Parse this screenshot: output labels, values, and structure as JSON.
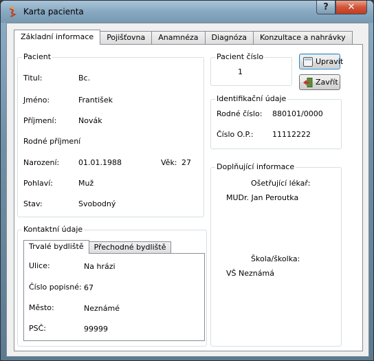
{
  "window": {
    "title": "Karta pacienta",
    "help_label": "?",
    "close_label": "✕"
  },
  "tabs": [
    "Základní informace",
    "Pojišťovna",
    "Anamnéza",
    "Diagnóza",
    "Konzultace a nahrávky"
  ],
  "pacient": {
    "group_title": "Pacient",
    "titul_label": "Titul:",
    "titul_value": "Bc.",
    "jmeno_label": "Jméno:",
    "jmeno_value": "František",
    "prijmeni_label": "Příjmení:",
    "prijmeni_value": "Novák",
    "rodne_prijmeni_label": "Rodné příjmení",
    "rodne_prijmeni_value": "",
    "narozeni_label": "Narození:",
    "narozeni_value": "01.01.1988",
    "vek_label": "Věk:",
    "vek_value": "27",
    "pohlavi_label": "Pohlaví:",
    "pohlavi_value": "Muž",
    "stav_label": "Stav:",
    "stav_value": "Svobodný"
  },
  "pacient_cislo": {
    "group_title": "Pacient číslo",
    "value": "1"
  },
  "buttons": {
    "upravit": "Upravit",
    "zavrit": "Zavřít"
  },
  "identifikace": {
    "group_title": "Identifikační údaje",
    "rodne_cislo_label": "Rodné číslo:",
    "rodne_cislo_value": "880101/0000",
    "cislo_op_label": "Číslo O.P.:",
    "cislo_op_value": "11112222"
  },
  "doplnujici": {
    "group_title": "Doplňující informace",
    "lekar_label": "Ošetřující lékař:",
    "lekar_value": "MUDr. Jan Peroutka",
    "skola_label": "Škola/školka:",
    "skola_value": "VŠ Neznámá"
  },
  "kontakt": {
    "group_title": "Kontaktní údaje",
    "subtabs": [
      "Trvalé bydliště",
      "Přechodné bydliště"
    ],
    "ulice_label": "Ulice:",
    "ulice_value": "Na hrázi",
    "cp_label": "Číslo popisné:",
    "cp_value": "67",
    "mesto_label": "Město:",
    "mesto_value": "Neznámé",
    "psc_label": "PSČ:",
    "psc_value": "99999"
  }
}
